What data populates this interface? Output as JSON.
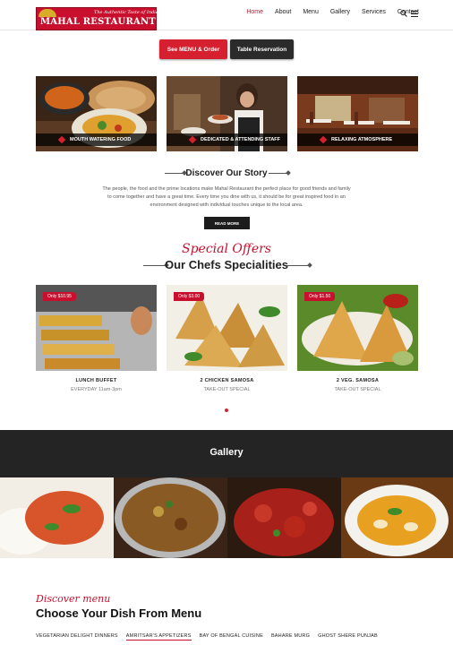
{
  "brand": {
    "tagline": "The Authentic Taste of India",
    "name": "Mahal Restaurant"
  },
  "nav": [
    "Home",
    "About",
    "Menu",
    "Gallery",
    "Services",
    "Contact"
  ],
  "cta": {
    "menu_order": "See MENU & Order",
    "table_reservation": "Table Reservation"
  },
  "features": [
    {
      "label": "MOUTH WATERING FOOD"
    },
    {
      "label": "DEDICATED & ATTENDING STAFF"
    },
    {
      "label": "RELAXING ATMOSPHERE"
    }
  ],
  "story": {
    "title": "Discover Our Story",
    "text": "The people, the food and the prime locations make Mahal Restaurant the perfect place for good friends and family to come together and have a great time. Every time you dine with us, it should be for great inspired food in an environment designed with individual touches unique to the local area.",
    "button": "READ MORE"
  },
  "specials": {
    "script_title": "Special Offers",
    "title": "Our Chefs Specialities",
    "items": [
      {
        "price": "Only  $10.95",
        "name": "LUNCH BUFFET",
        "sub": "EVERYDAY 11am-3pm"
      },
      {
        "price": "Only  $3.00",
        "name": "2 CHICKEN SAMOSA",
        "sub": "TAKE-OUT SPECIAL"
      },
      {
        "price": "Only  $1.50",
        "name": "2 VEG. SAMOSA",
        "sub": "TAKE-OUT SPECIAL"
      }
    ]
  },
  "gallery": {
    "title": "Gallery"
  },
  "menu": {
    "script_title": "Discover menu",
    "title": "Choose Your Dish From Menu",
    "tabs": [
      "VEGETARIAN DELIGHT DINNERS",
      "AMRITSAR'S APPETIZERS",
      "BAY OF BENGAL CUISINE",
      "BAHARE MURG",
      "GHOST SHERE PUNJAB"
    ],
    "active_tab": "AMRITSAR'S APPETIZERS"
  },
  "colors": {
    "accent": "#d7202f",
    "dark": "#242424"
  }
}
